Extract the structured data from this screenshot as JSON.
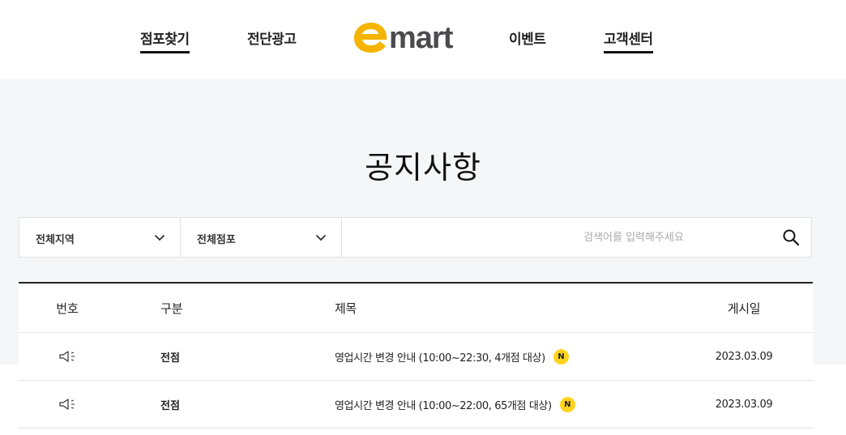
{
  "header": {
    "nav": [
      {
        "label": "점포찾기",
        "active": true
      },
      {
        "label": "전단광고",
        "active": false
      },
      {
        "label": "이벤트",
        "active": false
      },
      {
        "label": "고객센터",
        "active": true
      }
    ],
    "logo": {
      "text": "emart",
      "e_color": "#f5b400",
      "text_color": "#4a4a4f"
    }
  },
  "page_title": "공지사항",
  "filters": {
    "region_select": "전체지역",
    "store_select": "전체점포",
    "search_placeholder": "검색어를 입력해주세요",
    "search_value": ""
  },
  "table": {
    "columns": {
      "no": "번호",
      "category": "구분",
      "title": "제목",
      "date": "게시일"
    },
    "rows": [
      {
        "icon": "megaphone-icon",
        "category": "전점",
        "title": "영업시간 변경 안내 (10:00~22:30, 4개점 대상)",
        "badge": "N",
        "date": "2023.03.09"
      },
      {
        "icon": "megaphone-icon",
        "category": "전점",
        "title": "영업시간 변경 안내 (10:00~22:00, 65개점 대상)",
        "badge": "N",
        "date": "2023.03.09"
      }
    ]
  },
  "colors": {
    "accent_yellow": "#ffd31e",
    "band_gray": "#f5f6f8"
  }
}
